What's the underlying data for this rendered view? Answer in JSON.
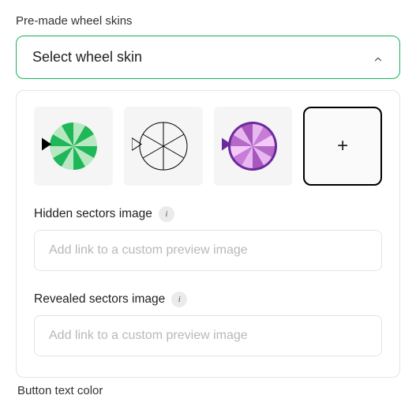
{
  "section_label": "Pre-made wheel skins",
  "select": {
    "label": "Select wheel skin"
  },
  "skins": {
    "add_glyph": "+"
  },
  "hidden": {
    "label": "Hidden sectors image",
    "info": "i",
    "placeholder": "Add link to a custom preview image"
  },
  "revealed": {
    "label": "Revealed sectors image",
    "info": "i",
    "placeholder": "Add link to a custom preview image"
  },
  "cutoff_label": "Button text color"
}
